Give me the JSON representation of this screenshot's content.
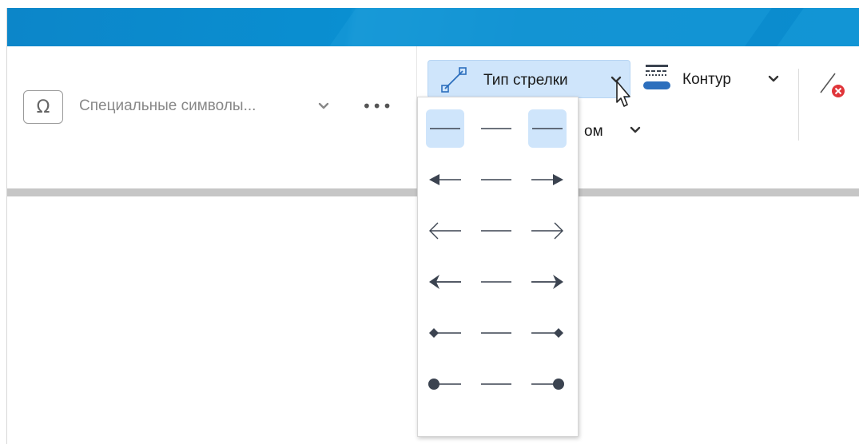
{
  "ribbon": {
    "special_symbols": {
      "icon": "omega-icon",
      "label": "Специальные символы..."
    },
    "more_icon": "more-dots-icon",
    "arrow_type": {
      "icon": "arrow-type-icon",
      "label": "Тип стрелки"
    },
    "contour": {
      "icon": "line-style-icon",
      "label": "Контур"
    },
    "hidden_label_fragment": "ом",
    "clear_icon": "no-outline-icon"
  },
  "arrow_menu": {
    "rows": [
      {
        "left": "plain",
        "middle": "plain",
        "right": "plain",
        "selected": [
          "left",
          "right"
        ]
      },
      {
        "left": "filled-arrow",
        "middle": "plain",
        "right": "filled-arrow",
        "selected": []
      },
      {
        "left": "open-arrow",
        "middle": "plain",
        "right": "open-arrow",
        "selected": []
      },
      {
        "left": "stealth-arrow",
        "middle": "plain",
        "right": "stealth-arrow",
        "selected": []
      },
      {
        "left": "diamond",
        "middle": "plain",
        "right": "diamond",
        "selected": []
      },
      {
        "left": "circle",
        "middle": "plain",
        "right": "circle",
        "selected": []
      }
    ]
  },
  "colors": {
    "titlebar": "#0a8ccf",
    "highlight": "#cfe5fb",
    "icon_dark": "#3b4350",
    "accent_red": "#e0353a",
    "accent_blue": "#2c6fbd"
  }
}
